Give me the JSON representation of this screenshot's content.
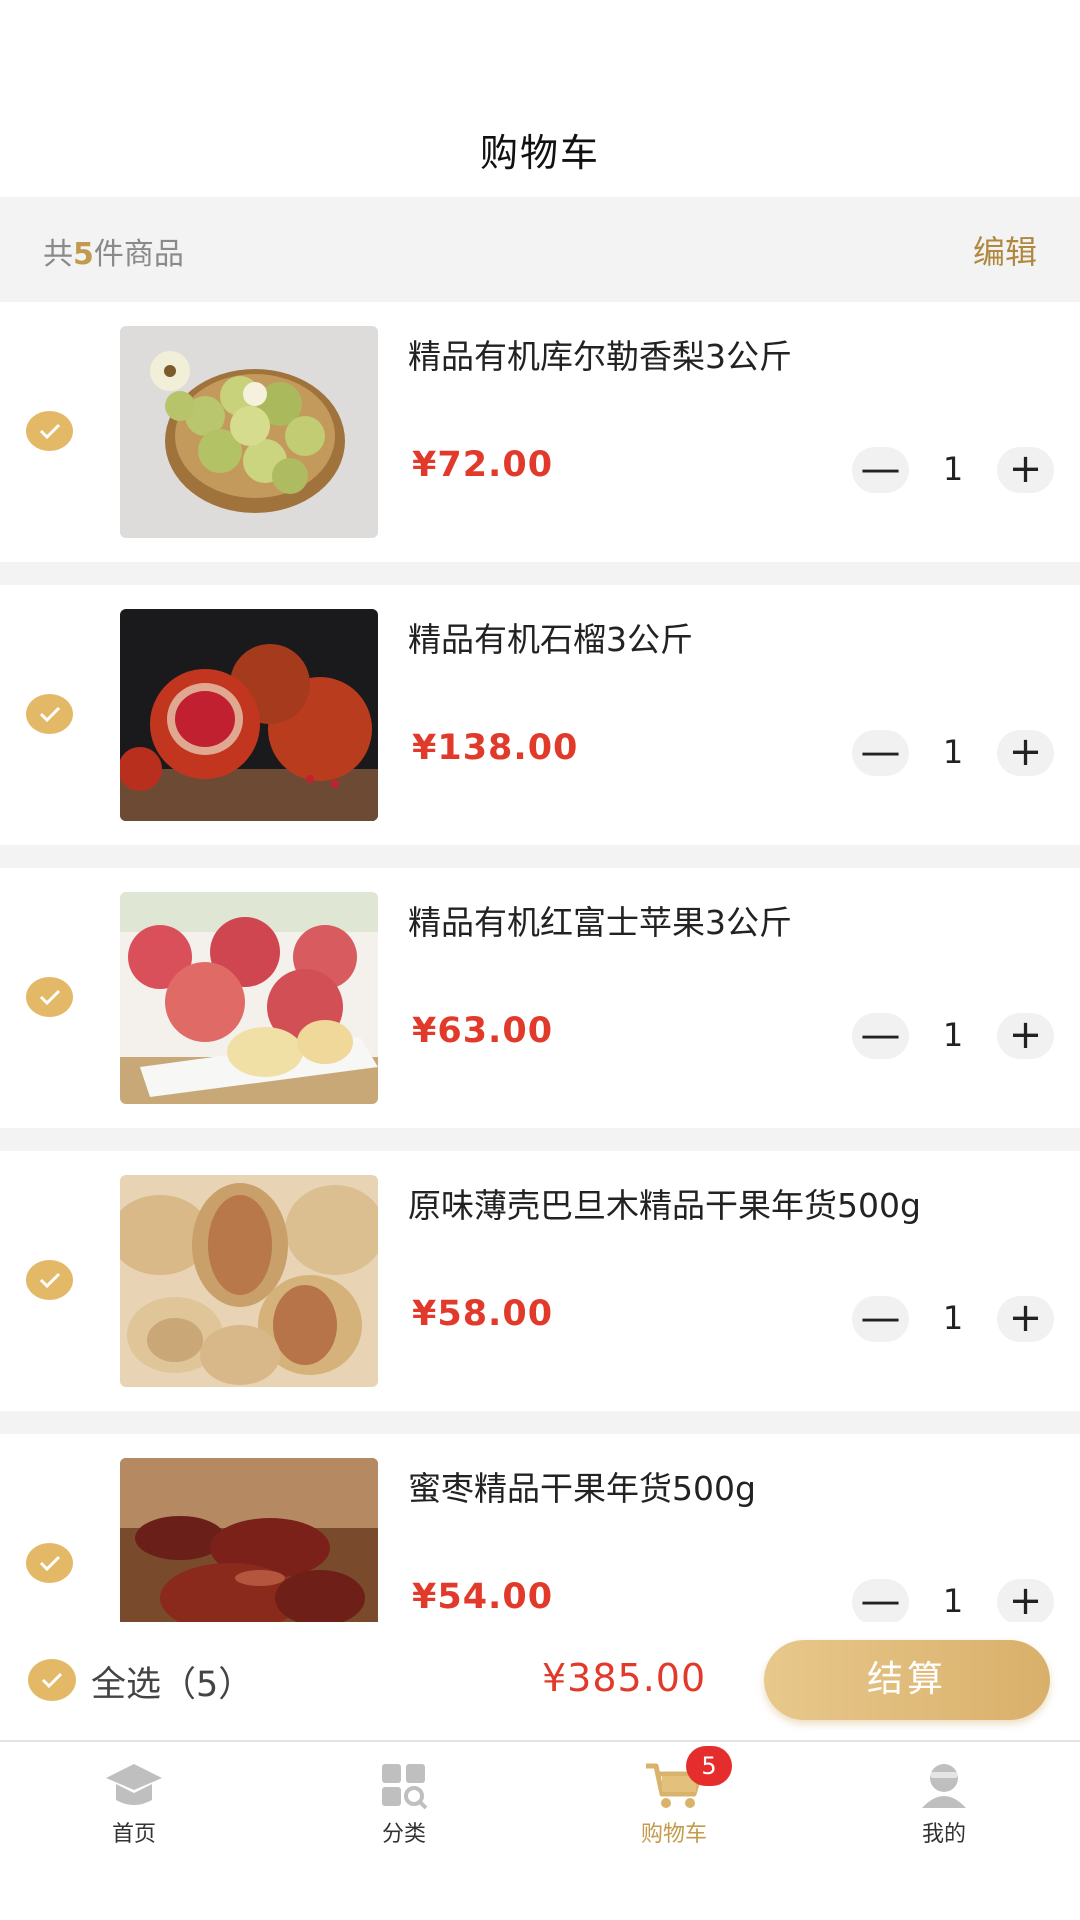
{
  "header": {
    "title": "购物车"
  },
  "summary": {
    "prefix": "共",
    "count": "5",
    "suffix": "件商品",
    "edit_label": "编辑"
  },
  "items": [
    {
      "name": "精品有机库尔勒香梨3公斤",
      "price": "¥72.00",
      "qty": "1",
      "checked": true,
      "image": "pear-basket"
    },
    {
      "name": "精品有机石榴3公斤",
      "price": "¥138.00",
      "qty": "1",
      "checked": true,
      "image": "pomegranates"
    },
    {
      "name": "精品有机红富士苹果3公斤",
      "price": "¥63.00",
      "qty": "1",
      "checked": true,
      "image": "red-apples"
    },
    {
      "name": "原味薄壳巴旦木精品干果年货500g",
      "price": "¥58.00",
      "qty": "1",
      "checked": true,
      "image": "almonds"
    },
    {
      "name": "蜜枣精品干果年货500g",
      "price": "¥54.00",
      "qty": "1",
      "checked": true,
      "image": "dates"
    }
  ],
  "stepper": {
    "minus": "—",
    "plus": "+"
  },
  "checkout": {
    "select_all_label": "全选（5）",
    "total": "¥385.00",
    "pay_label": "结算"
  },
  "tabbar": {
    "tabs": [
      {
        "label": "首页",
        "icon": "home-icon",
        "active": false
      },
      {
        "label": "分类",
        "icon": "category-icon",
        "active": false
      },
      {
        "label": "购物车",
        "icon": "cart-icon",
        "active": true,
        "badge": "5"
      },
      {
        "label": "我的",
        "icon": "profile-icon",
        "active": false
      }
    ]
  },
  "colors": {
    "accent": "#c49a4d",
    "price_red": "#e23a2a",
    "check_gold": "#e3b866",
    "badge_red": "#e52d2d"
  }
}
